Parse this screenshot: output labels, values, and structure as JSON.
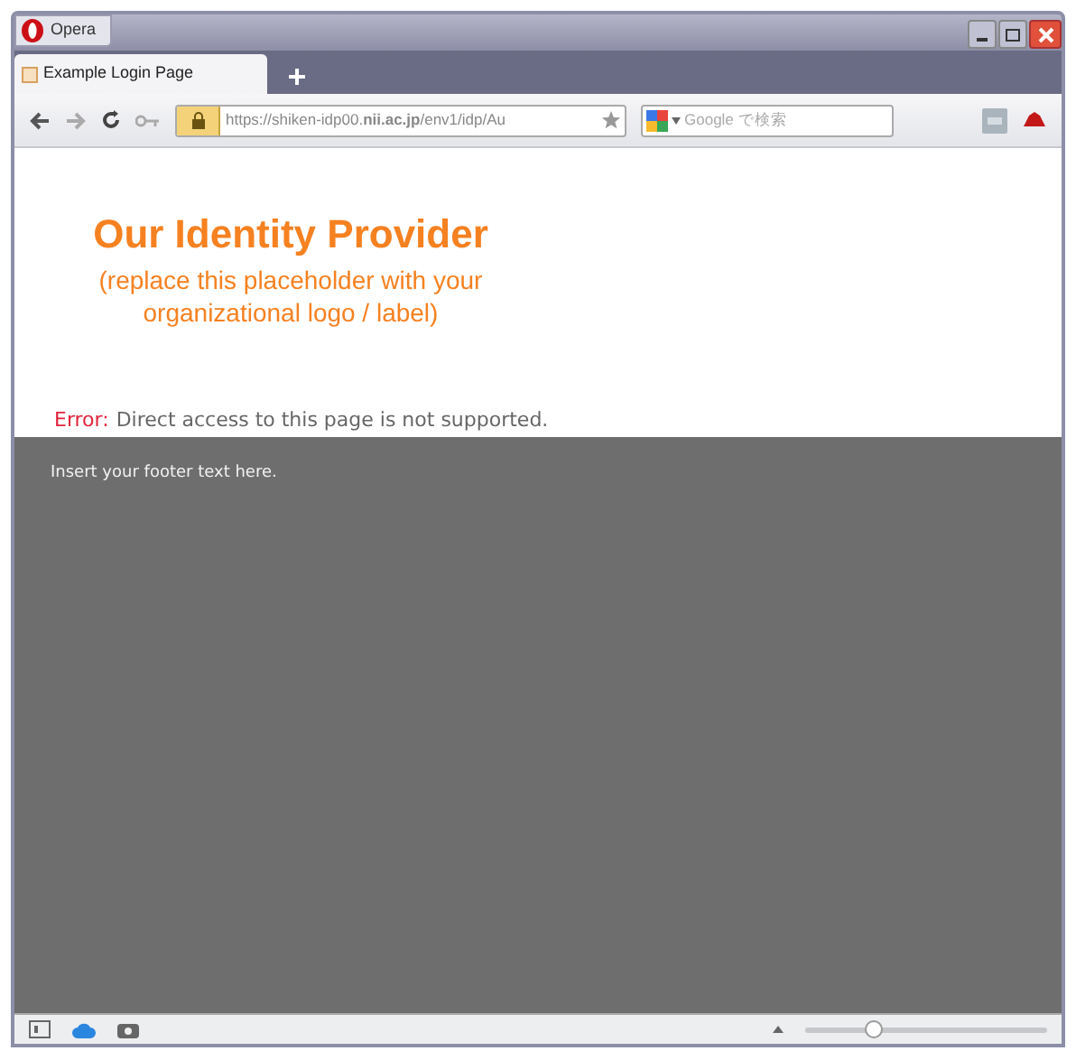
{
  "window": {
    "menu_button": "Opera"
  },
  "tabs": [
    {
      "label": "Example Login Page",
      "selected": true
    }
  ],
  "address_bar": {
    "url": "https://shiken-idp00.**nii.ac.jp**/env1/idp/Au"
  },
  "search": {
    "placeholder": "Google で検索"
  },
  "page": {
    "logo_title": "Our Identity Provider",
    "logo_subtitle": "(replace this placeholder with your organizational logo / label)",
    "error_label": "Error:",
    "error_message": "Direct access to this page is not supported.",
    "footer": "Insert your footer text here."
  },
  "status_bar": {
    "zoom": {
      "level": 0.28
    }
  }
}
